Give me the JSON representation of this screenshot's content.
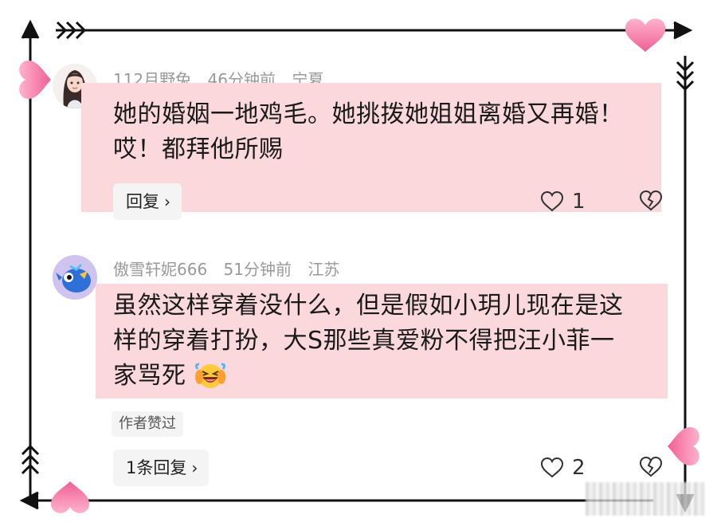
{
  "comments": [
    {
      "username": "112月野兔",
      "time": "46分钟前",
      "location": "宁夏",
      "line1": "她的婚姻一地鸡毛。她挑拨她姐姐离婚又再婚！",
      "line2": "哎！都拜他所赐",
      "reply_label": "回复",
      "like_count": "1",
      "avatar_icon": "girl-avatar-icon"
    },
    {
      "username": "傲雪轩妮666",
      "time": "51分钟前",
      "location": "江苏",
      "line1": "虽然这样穿着没什么，但是假如小玥儿现在是这",
      "line2": "样的穿着打扮，大S那些真爱粉不得把汪小菲一",
      "line3": "家骂死",
      "emoji": "laughing-crying-emoji",
      "author_tag": "作者赞过",
      "reply_label": "1条回复",
      "like_count": "2",
      "avatar_icon": "blue-bird-avatar-icon"
    }
  ],
  "colors": {
    "highlight": "#fad8dc",
    "heart": "#f27aa6",
    "frame": "#111111"
  }
}
